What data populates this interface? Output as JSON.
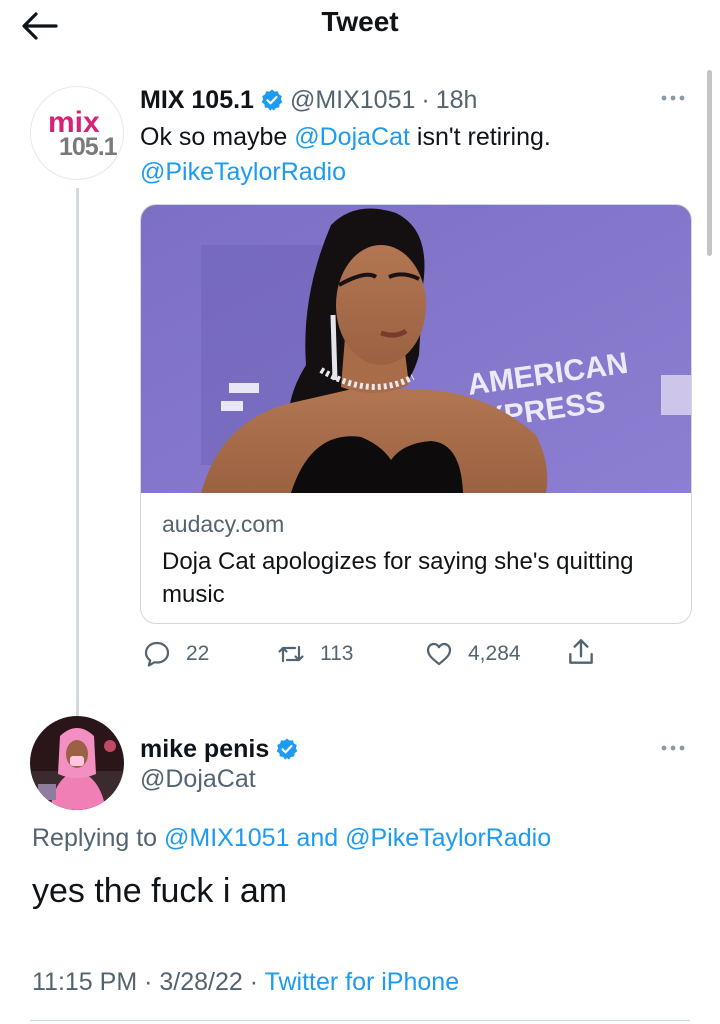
{
  "header": {
    "title": "Tweet",
    "back_icon": "arrow-left-icon"
  },
  "tweet": {
    "avatar_logo_top": "mix",
    "avatar_logo_bottom": "105.1",
    "author_name": "MIX 105.1",
    "verified": true,
    "handle": "@MIX1051",
    "separator": "·",
    "time": "18h",
    "text_prefix": "Ok so maybe ",
    "text_mention": "@DojaCat",
    "text_suffix": " isn't retiring.",
    "text_mention2": "@PikeTaylorRadio",
    "card": {
      "image_text_1": "AMERICAN",
      "image_text_2": "EXPRESS",
      "domain": "audacy.com",
      "title": "Doja Cat apologizes for saying she's quitting music"
    },
    "stats": {
      "replies": "22",
      "retweets": "113",
      "likes": "4,284"
    }
  },
  "reply": {
    "author_name": "mike penis",
    "verified": true,
    "handle": "@DojaCat",
    "replying_label": "Replying to ",
    "replying_to_1": "@MIX1051",
    "replying_and": " and ",
    "replying_to_2": "@PikeTaylorRadio",
    "text": "yes the fuck i am",
    "time": "11:15 PM",
    "separator": " · ",
    "date": "3/28/22",
    "source": "Twitter for iPhone"
  },
  "colors": {
    "accent": "#1d9bf0",
    "text": "#0f1419",
    "muted": "#536471",
    "border": "#cfd9de",
    "brand_mix": "#d6237a"
  }
}
